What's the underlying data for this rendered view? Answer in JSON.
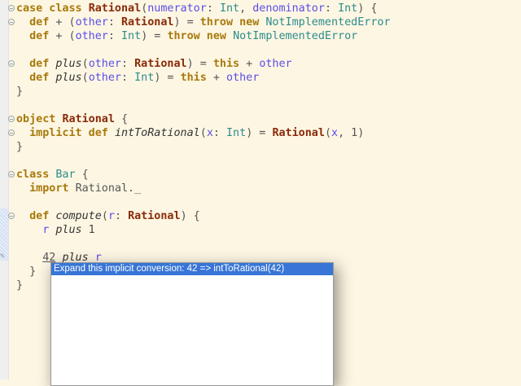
{
  "editor": {
    "lines": [
      [
        [
          "case class ",
          "kw"
        ],
        [
          "Rational",
          "cls"
        ],
        [
          "(",
          "op"
        ],
        [
          "numerator",
          "prm"
        ],
        [
          ": ",
          "op"
        ],
        [
          "Int",
          "typ"
        ],
        [
          ", ",
          "op"
        ],
        [
          "denominator",
          "prm"
        ],
        [
          ": ",
          "op"
        ],
        [
          "Int",
          "typ"
        ],
        [
          ") {",
          "op"
        ]
      ],
      [
        [
          "  def ",
          "kw"
        ],
        [
          "+ (",
          "op"
        ],
        [
          "other",
          "prm"
        ],
        [
          ": ",
          "op"
        ],
        [
          "Rational",
          "cls"
        ],
        [
          ") = ",
          "op"
        ],
        [
          "throw new ",
          "kw"
        ],
        [
          "NotImplementedError",
          "typ"
        ]
      ],
      [
        [
          "  def ",
          "kw"
        ],
        [
          "+ (",
          "op"
        ],
        [
          "other",
          "prm"
        ],
        [
          ": ",
          "op"
        ],
        [
          "Int",
          "typ"
        ],
        [
          ") = ",
          "op"
        ],
        [
          "throw new ",
          "kw"
        ],
        [
          "NotImplementedError",
          "typ"
        ]
      ],
      [],
      [
        [
          "  def ",
          "kw"
        ],
        [
          "plus",
          "it"
        ],
        [
          "(",
          "op"
        ],
        [
          "other",
          "prm"
        ],
        [
          ": ",
          "op"
        ],
        [
          "Rational",
          "cls"
        ],
        [
          ") = ",
          "op"
        ],
        [
          "this",
          "kw"
        ],
        [
          " + ",
          "op"
        ],
        [
          "other",
          "prm"
        ]
      ],
      [
        [
          "  def ",
          "kw"
        ],
        [
          "plus",
          "it"
        ],
        [
          "(",
          "op"
        ],
        [
          "other",
          "prm"
        ],
        [
          ": ",
          "op"
        ],
        [
          "Int",
          "typ"
        ],
        [
          ") = ",
          "op"
        ],
        [
          "this",
          "kw"
        ],
        [
          " + ",
          "op"
        ],
        [
          "other",
          "prm"
        ]
      ],
      [
        [
          "}",
          "op"
        ]
      ],
      [],
      [
        [
          "object ",
          "kw"
        ],
        [
          "Rational",
          "cls"
        ],
        [
          " {",
          "op"
        ]
      ],
      [
        [
          "  implicit def ",
          "kw"
        ],
        [
          "intToRational",
          "it"
        ],
        [
          "(",
          "op"
        ],
        [
          "x",
          "prm"
        ],
        [
          ": ",
          "op"
        ],
        [
          "Int",
          "typ"
        ],
        [
          ") = ",
          "op"
        ],
        [
          "Rational",
          "cls"
        ],
        [
          "(",
          "op"
        ],
        [
          "x",
          "prm"
        ],
        [
          ", 1)",
          "op"
        ]
      ],
      [
        [
          "}",
          "op"
        ]
      ],
      [],
      [
        [
          "class ",
          "kw"
        ],
        [
          "Bar",
          "typ"
        ],
        [
          " {",
          "op"
        ]
      ],
      [
        [
          "  import ",
          "kw"
        ],
        [
          "Rational._",
          "imp"
        ]
      ],
      [],
      [
        [
          "  def ",
          "kw"
        ],
        [
          "compute",
          "it"
        ],
        [
          "(",
          "op"
        ],
        [
          "r",
          "prm"
        ],
        [
          ": ",
          "op"
        ],
        [
          "Rational",
          "cls"
        ],
        [
          ") {",
          "op"
        ]
      ],
      [
        [
          "    ",
          "op"
        ],
        [
          "r",
          "prm"
        ],
        [
          " ",
          "op"
        ],
        [
          "plus",
          "it"
        ],
        [
          " 1",
          "pl"
        ]
      ],
      [],
      [
        [
          "    ",
          "op"
        ],
        [
          "42",
          "ul"
        ],
        [
          " ",
          "op"
        ],
        [
          "plus",
          "it"
        ],
        [
          " ",
          "op"
        ],
        [
          "r",
          "prm"
        ]
      ],
      [
        [
          "  }",
          "op"
        ]
      ],
      [
        [
          "}",
          "op"
        ]
      ]
    ],
    "fold_lines": [
      0,
      1,
      4,
      8,
      9,
      12,
      15
    ]
  },
  "popup": {
    "items": [
      "Expand this implicit conversion: 42 => intToRational(42)"
    ]
  }
}
